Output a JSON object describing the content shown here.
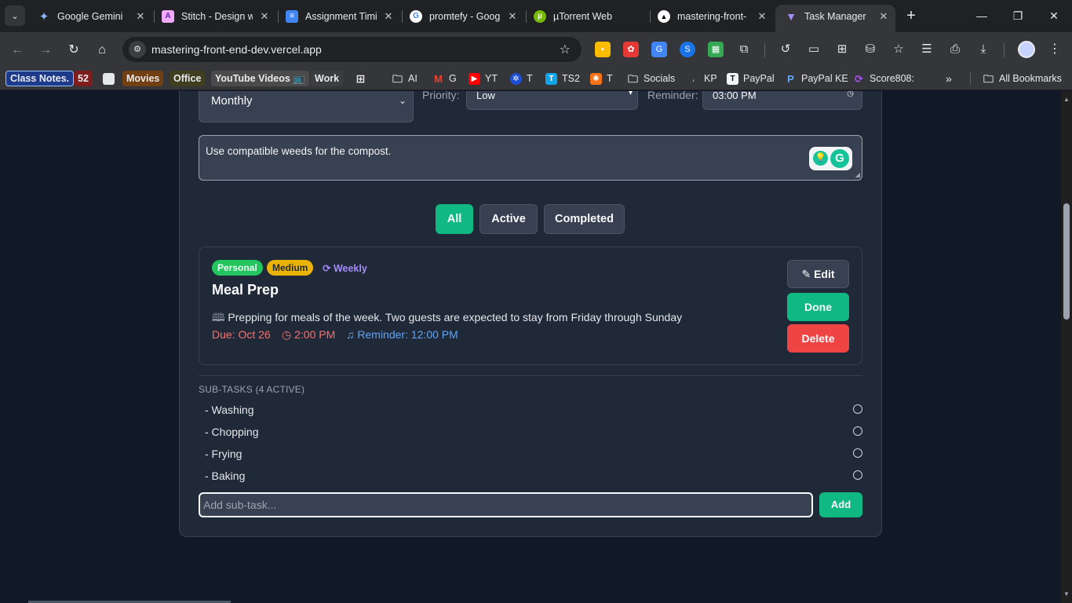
{
  "browser": {
    "tabs": [
      {
        "title": "Google Gemini",
        "icon": "gemini-icon",
        "active": false
      },
      {
        "title": "Stitch - Design w",
        "icon": "stitch-icon",
        "active": false
      },
      {
        "title": "Assignment Timi",
        "icon": "docs-icon",
        "active": false
      },
      {
        "title": "promtefy - Goog",
        "icon": "google-icon",
        "active": false
      },
      {
        "title": "µTorrent Web",
        "icon": "utorrent-icon",
        "active": false
      },
      {
        "title": "mastering-front-",
        "icon": "vercel-icon",
        "active": false
      },
      {
        "title": "Task Manager",
        "icon": "vite-icon",
        "active": true
      }
    ],
    "url": "mastering-front-end-dev.vercel.app",
    "bookmarks": [
      {
        "label": "Class Notes.",
        "icon": ""
      },
      {
        "label": "52",
        "icon": ""
      },
      {
        "label": "",
        "icon": "square-icon"
      },
      {
        "label": "Movies",
        "icon": ""
      },
      {
        "label": "Office",
        "icon": ""
      },
      {
        "label": "YouTube Videos 📺",
        "icon": ""
      },
      {
        "label": "Work",
        "icon": ""
      },
      {
        "label": "",
        "icon": "apps-grid-icon"
      },
      {
        "label": "AI",
        "icon": "folder-icon"
      },
      {
        "label": "G",
        "icon": "gmail-icon"
      },
      {
        "label": "YT",
        "icon": "youtube-icon"
      },
      {
        "label": "T",
        "icon": "t-icon"
      },
      {
        "label": "TS2",
        "icon": "ts2-icon"
      },
      {
        "label": "T",
        "icon": "t2-icon"
      },
      {
        "label": "Socials",
        "icon": "folder-icon"
      },
      {
        "label": "KP",
        "icon": "kp-icon"
      },
      {
        "label": "PayPal",
        "icon": "paypal-t-icon"
      },
      {
        "label": "PayPal KE",
        "icon": "paypal-icon"
      },
      {
        "label": "Score808:",
        "icon": "score-icon"
      },
      {
        "label": "All Bookmarks",
        "icon": "folder-icon"
      }
    ],
    "more_label": "»"
  },
  "form": {
    "recurrence_value": "Monthly",
    "priority_label": "Priority:",
    "priority_value": "Low",
    "reminder_label": "Reminder:",
    "reminder_value": "03:00 PM",
    "notes_value": "Use compatible weeds for the compost."
  },
  "filters": [
    {
      "label": "All",
      "active": true
    },
    {
      "label": "Active",
      "active": false
    },
    {
      "label": "Completed",
      "active": false
    }
  ],
  "task": {
    "category": "Personal",
    "priority": "Medium",
    "recurrence": "Weekly",
    "title": "Meal Prep",
    "description": "Prepping for meals of the week. Two guests are expected to stay from Friday through Sunday",
    "due": "Due: Oct 26",
    "due_time": "2:00 PM",
    "reminder": "Reminder: 12:00 PM",
    "edit_label": "Edit",
    "done_label": "Done",
    "delete_label": "Delete"
  },
  "subtasks": {
    "heading": "SUB-TASKS (4 ACTIVE)",
    "items": [
      {
        "label": "- Washing",
        "completed": false
      },
      {
        "label": "- Chopping",
        "completed": false
      },
      {
        "label": "- Frying",
        "completed": false
      },
      {
        "label": "- Baking",
        "completed": false
      }
    ],
    "input_placeholder": "Add sub-task...",
    "add_label": "Add"
  },
  "colors": {
    "accent": "#10b981",
    "danger": "#ef4444",
    "warning": "#eab308",
    "recurrence": "#a78bfa",
    "due": "#f87171",
    "reminder": "#60a5fa"
  }
}
